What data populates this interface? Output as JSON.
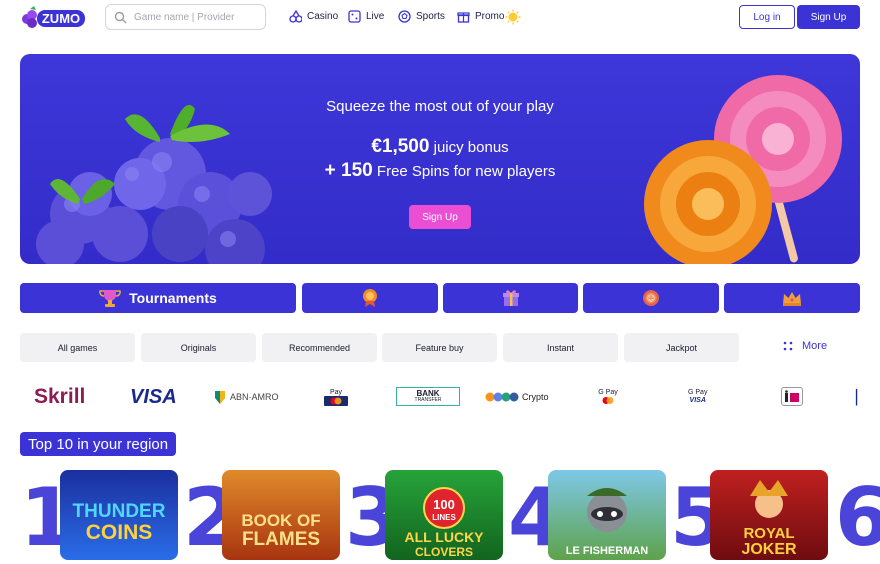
{
  "header": {
    "logo_text": "ZUMO",
    "search_placeholder": "Game name | Provider",
    "nav": [
      {
        "label": "Casino",
        "icon": "slots-icon"
      },
      {
        "label": "Live",
        "icon": "dice-icon"
      },
      {
        "label": "Sports",
        "icon": "ball-icon"
      },
      {
        "label": "Promo",
        "icon": "gift-icon"
      }
    ],
    "login_label": "Log in",
    "signup_label": "Sign Up"
  },
  "hero": {
    "headline": "Squeeze the most out of your play",
    "bonus_amount": "€1,500",
    "bonus_text": "juicy bonus",
    "spins_amount": "+ 150",
    "spins_text": "Free Spins for new players",
    "cta_label": "Sign Up"
  },
  "categories": [
    {
      "label": "Tournaments",
      "icon": "trophy-icon"
    },
    {
      "label": "",
      "icon": "medal-icon"
    },
    {
      "label": "",
      "icon": "gift-box-icon"
    },
    {
      "label": "",
      "icon": "coin-icon"
    },
    {
      "label": "",
      "icon": "crown-icon"
    }
  ],
  "filters": [
    "All games",
    "Originals",
    "Recommended",
    "Feature buy",
    "Instant",
    "Jackpot"
  ],
  "more_label": "More",
  "payments": {
    "skrill": "Skrill",
    "visa": "VISA",
    "abn": "ABN·AMRO",
    "apple_pay": "Pay",
    "bank_transfer_1": "BANK",
    "bank_transfer_2": "TRANSFER",
    "crypto": "Crypto",
    "gpay": "G Pay",
    "gpay_visa_1": "G Pay",
    "gpay_visa_2": "VISA",
    "ideal": "iDEAL"
  },
  "section_title": "Top 10 in your region",
  "games": [
    {
      "rank": "1",
      "title_1": "THUNDER",
      "title_2": "COINS",
      "bg": "#1e4fd0"
    },
    {
      "rank": "2",
      "title_1": "BOOK OF",
      "title_2": "FLAMES",
      "bg": "#c24a12"
    },
    {
      "rank": "3",
      "title_1": "100",
      "title_2": "LINES",
      "title_3": "ALL LUCKY",
      "title_4": "CLOVERS",
      "bg": "#1d8a2c"
    },
    {
      "rank": "4",
      "title_1": "LE FISHERMAN",
      "bg": "#6ea65c"
    },
    {
      "rank": "5",
      "title_1": "ROYAL",
      "title_2": "JOKER",
      "bg": "#9b1418"
    },
    {
      "rank": "6"
    }
  ],
  "colors": {
    "primary": "#3b33d6",
    "hero": "#3a33d4",
    "cta": "#ea4fd3"
  }
}
